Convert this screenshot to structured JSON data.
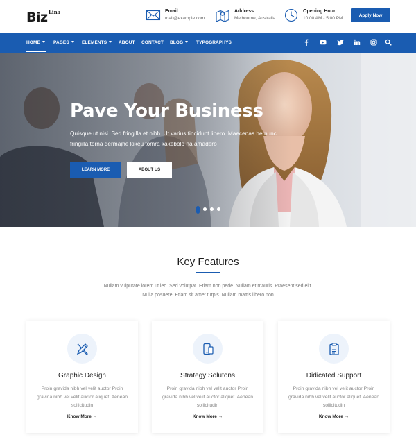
{
  "brand": {
    "name": "Biz",
    "sup": "Lina"
  },
  "topinfo": [
    {
      "icon": "email-icon",
      "label": "Email",
      "value": "mail@example.com"
    },
    {
      "icon": "map-icon",
      "label": "Address",
      "value": "Melbourne, Australia"
    },
    {
      "icon": "clock-icon",
      "label": "Opening Hour",
      "value": "10:00 AM - 5:00 PM"
    }
  ],
  "apply_label": "Apply Now",
  "nav": {
    "items": [
      {
        "label": "HOME",
        "caret": true,
        "active": true
      },
      {
        "label": "PAGES",
        "caret": true
      },
      {
        "label": "ELEMENTS",
        "caret": true
      },
      {
        "label": "ABOUT"
      },
      {
        "label": "CONTACT"
      },
      {
        "label": "BLOG",
        "caret": true
      },
      {
        "label": "TYPOGRAPHYS"
      }
    ],
    "social_icons": [
      "facebook-icon",
      "youtube-icon",
      "twitter-icon",
      "linkedin-icon",
      "instagram-icon",
      "search-icon"
    ]
  },
  "hero": {
    "title": "Pave Your Business",
    "text_line1": "Quisque ut nisi. Sed fringilla et nibh. Ut varius tincidunt libero. Maecenas he nunc",
    "text_line2": "fringilla torna dermajhe kikeu tomra kakebolo na amadero",
    "learn_more": "LEARN MORE",
    "about_us": "ABOUT US",
    "slides": 4,
    "active_slide": 1
  },
  "features": {
    "title": "Key Features",
    "desc_line1": "Nullam vulputate lorem ut leo. Sed volutpat. Etiam non pede. Nullam et mauris. Praesent sed elit.",
    "desc_line2": "Nulla posuere. Etiam sit amet turpis. Nullam mattis libero non",
    "cards": [
      {
        "icon": "design-tools-icon",
        "title": "Graphic Design",
        "text": "Proin gravida nibh vel velit auctor Proin gravida nibh vel velit auctor aliquet. Aenean sollicitudin",
        "link": "Know More →"
      },
      {
        "icon": "devices-icon",
        "title": "Strategy Solutons",
        "text": "Proin gravida nibh vel velit auctor Proin gravida nibh vel velit auctor aliquet. Aenean sollicitudin",
        "link": "Know More →"
      },
      {
        "icon": "clipboard-icon",
        "title": "Didicated Support",
        "text": "Proin gravida nibh vel velit auctor Proin gravida nibh vel velit auctor aliquet. Aenean sollicitudin",
        "link": "Know More →"
      }
    ]
  },
  "colors": {
    "accent": "#1a5cb1",
    "icon_bg": "#edf3fb"
  }
}
